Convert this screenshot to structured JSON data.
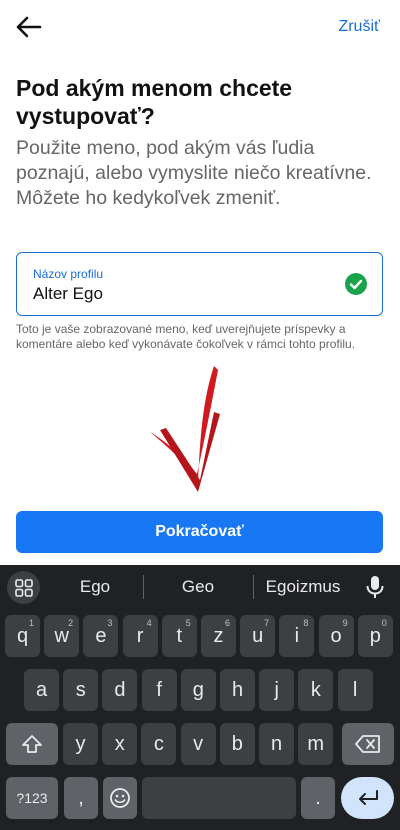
{
  "topbar": {
    "cancel_label": "Zrušiť"
  },
  "main": {
    "title": "Pod akým menom chcete vystupovať?",
    "subtitle": "Použite meno, pod akým vás ľudia poznajú, alebo vymyslite niečo kreatívne. Môžete ho kedykoľvek zmeniť.",
    "field": {
      "label": "Názov profilu",
      "value": "Alter Ego"
    },
    "helper": "Toto je vaše zobrazované meno, keď uverejňujete príspevky a komentáre alebo keď vykonávate čokoľvek v rámci tohto profilu.",
    "continue_label": "Pokračovať"
  },
  "keyboard": {
    "suggestions": [
      "Ego",
      "Geo",
      "Egoizmus"
    ],
    "row1": [
      {
        "k": "q",
        "h": "1"
      },
      {
        "k": "w",
        "h": "2"
      },
      {
        "k": "e",
        "h": "3"
      },
      {
        "k": "r",
        "h": "4"
      },
      {
        "k": "t",
        "h": "5"
      },
      {
        "k": "z",
        "h": "6"
      },
      {
        "k": "u",
        "h": "7"
      },
      {
        "k": "i",
        "h": "8"
      },
      {
        "k": "o",
        "h": "9"
      },
      {
        "k": "p",
        "h": "0"
      }
    ],
    "row2": [
      "a",
      "s",
      "d",
      "f",
      "g",
      "h",
      "j",
      "k",
      "l"
    ],
    "row3": [
      "y",
      "x",
      "c",
      "v",
      "b",
      "n",
      "m"
    ],
    "symbols_label": "?123",
    "comma_label": ",",
    "period_label": "."
  },
  "colors": {
    "accent": "#1877f2",
    "link": "#1a6ed8",
    "success": "#1aa34a",
    "arrow": "#d11a1f",
    "keyboard_bg": "#202124"
  }
}
